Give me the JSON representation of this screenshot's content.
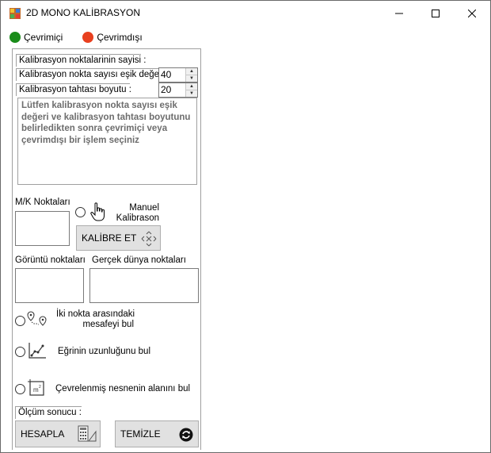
{
  "window": {
    "title": "2D MONO KALİBRASYON"
  },
  "status": {
    "online_label": "Çevrimiçi",
    "offline_label": "Çevrimdışı",
    "online_color": "#1a8c1a",
    "offline_color": "#e8401f"
  },
  "calibration": {
    "points_count_label": "Kalibrasyon noktalarinin sayisi :",
    "threshold_label": "Kalibrasyon nokta sayısı eşik değeri :",
    "threshold_value": "40",
    "board_size_label": "Kalibrasyon tahtası boyutu :",
    "board_size_value": "20",
    "info_text": "Lütfen kalibrasyon nokta sayısı eşik değeri ve kalibrasyon tahtası boyutunu belirledikten sonra çevrimiçi veya çevrimdışı bir işlem seçiniz"
  },
  "manual": {
    "mk_points_label": "M/K Noktaları",
    "manual_line1": "Manuel",
    "manual_line2": "Kalibrason",
    "calibrate_button": "KALİBRE ET"
  },
  "points": {
    "image_points_label": "Görüntü noktaları",
    "world_points_label": "Gerçek dünya noktaları"
  },
  "options": {
    "distance_line1": "İki nokta arasındaki",
    "distance_line2": "mesafeyi bul",
    "curve_label": "Eğrinin uzunluğunu bul",
    "area_label": "Çevrelenmiş nesnenin alanını bul"
  },
  "result": {
    "label": "Ölçüm sonucu :",
    "calculate_button": "HESAPLA",
    "clear_button": "TEMİZLE"
  }
}
